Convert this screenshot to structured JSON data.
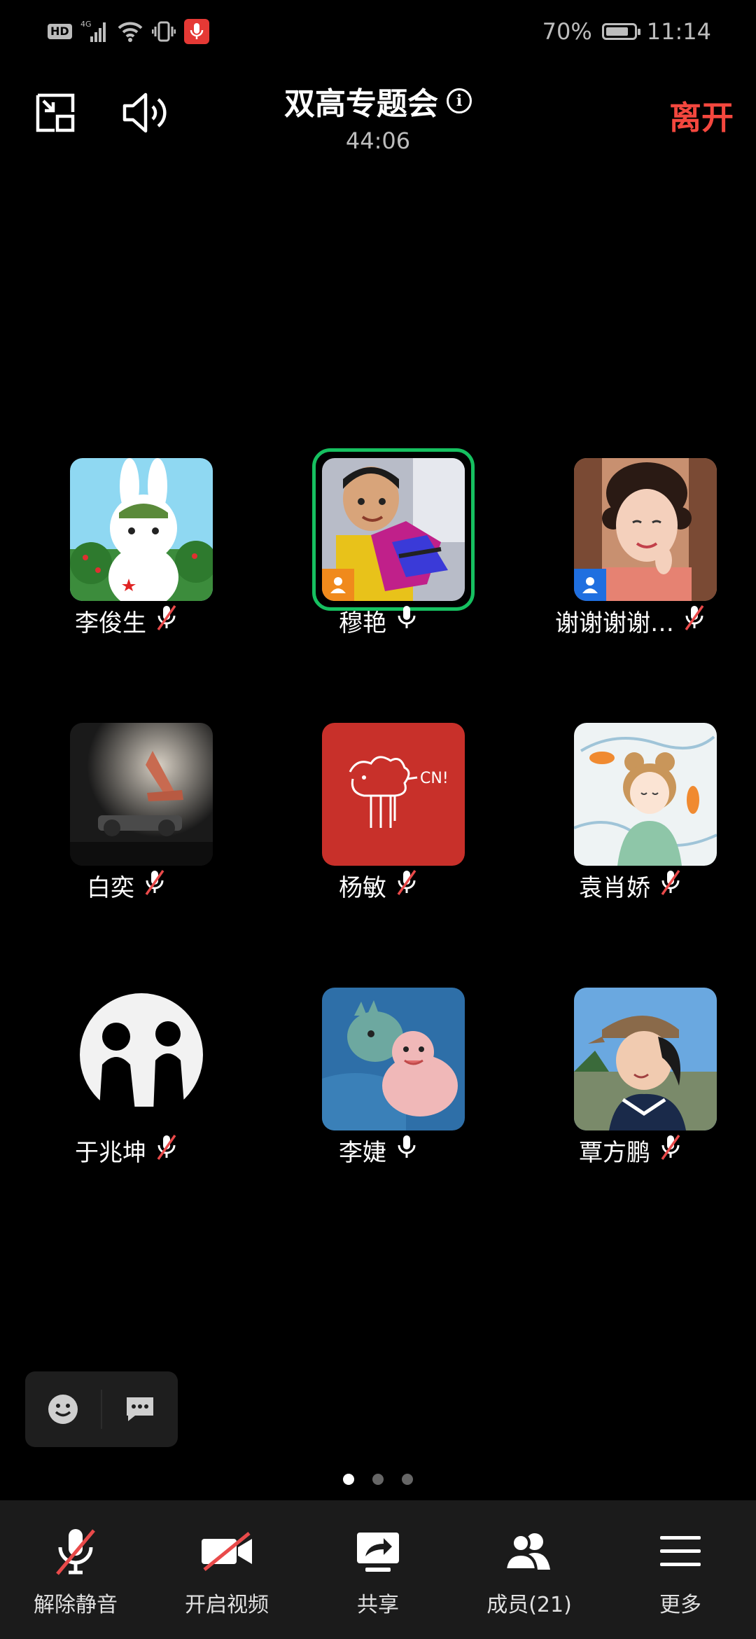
{
  "status_bar": {
    "hd_label": "HD",
    "network_label": "4G",
    "battery_percent": "70%",
    "time": "11:14"
  },
  "meeting": {
    "title": "双高专题会",
    "info_symbol": "i",
    "elapsed": "44:06",
    "leave_label": "离开"
  },
  "participants": [
    {
      "name": "李俊生",
      "mic": "muted",
      "host": false,
      "speaking": false
    },
    {
      "name": "穆艳",
      "mic": "on",
      "host": true,
      "speaking": true
    },
    {
      "name": "谢谢谢谢…",
      "mic": "muted",
      "host": true,
      "speaking": false
    },
    {
      "name": "白奕",
      "mic": "muted",
      "host": false,
      "speaking": false
    },
    {
      "name": "杨敏",
      "mic": "muted",
      "host": false,
      "speaking": false
    },
    {
      "name": "袁肖娇",
      "mic": "muted",
      "host": false,
      "speaking": false
    },
    {
      "name": "于兆坤",
      "mic": "muted",
      "host": false,
      "speaking": false
    },
    {
      "name": "李婕",
      "mic": "on",
      "host": false,
      "speaking": false
    },
    {
      "name": "覃方鹏",
      "mic": "muted",
      "host": false,
      "speaking": false
    }
  ],
  "pager": {
    "pages": 3,
    "current": 1
  },
  "toolbar": {
    "unmute_label": "解除静音",
    "video_label": "开启视频",
    "share_label": "共享",
    "members_label": "成员(21)",
    "more_label": "更多"
  },
  "colors": {
    "leave": "#f4473e",
    "speaking_ring": "#16c060",
    "host_orange": "#f08a1c",
    "host_blue": "#1f6fe0",
    "mute_slash": "#e94a4a"
  }
}
